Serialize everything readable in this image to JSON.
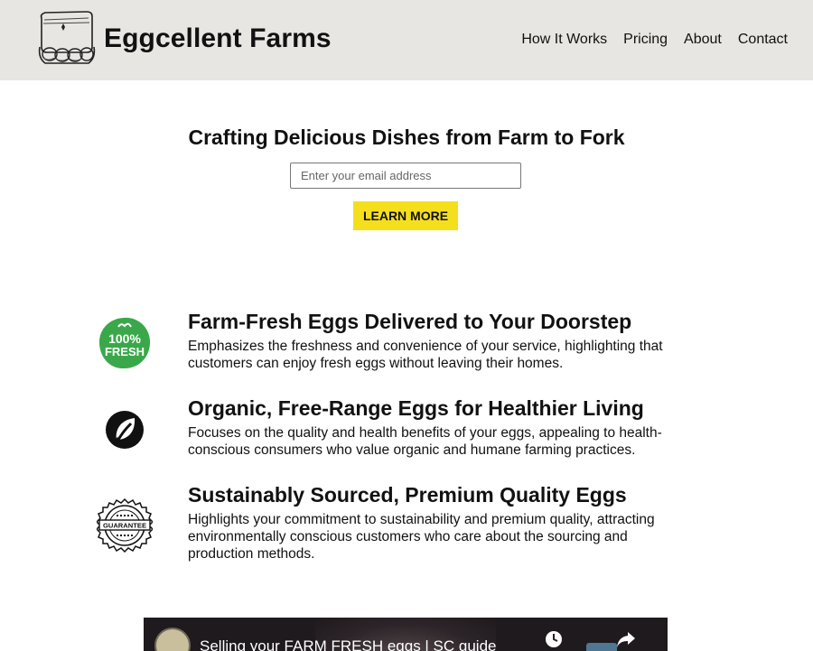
{
  "header": {
    "brand": "Eggcellent Farms",
    "logo_icon": "egg-carton-icon",
    "nav": [
      "How It Works",
      "Pricing",
      "About",
      "Contact"
    ],
    "background": "#e8e6e3"
  },
  "hero": {
    "title": "Crafting Delicious Dishes from Farm to Fork",
    "email_placeholder": "Enter your email address",
    "cta_label": "LEARN MORE",
    "cta_color": "#f5df1d"
  },
  "features": [
    {
      "icon": "fresh-badge-icon",
      "icon_text": [
        "100%",
        "FRESH"
      ],
      "title": "Farm-Fresh Eggs Delivered to Your Doorstep",
      "description": "Emphasizes the freshness and convenience of your service, highlighting that customers can enjoy fresh eggs without leaving their homes."
    },
    {
      "icon": "leaf-icon",
      "title": "Organic, Free-Range Eggs for Healthier Living",
      "description": "Focuses on the quality and health benefits of your eggs, appealing to health-conscious consumers who value organic and humane farming practices."
    },
    {
      "icon": "guarantee-seal-icon",
      "icon_text": "GUARANTEE",
      "title": "Sustainably Sourced, Premium Quality Eggs",
      "description": "Highlights your commitment to sustainability and premium quality, attracting environmentally conscious customers who care about the sourcing and production methods."
    }
  ],
  "video": {
    "title": "Selling your FARM FRESH eggs | SC guide",
    "icons": [
      "clock-icon",
      "share-icon"
    ]
  },
  "colors": {
    "fresh_green": "#3aa84a",
    "text": "#111111"
  }
}
